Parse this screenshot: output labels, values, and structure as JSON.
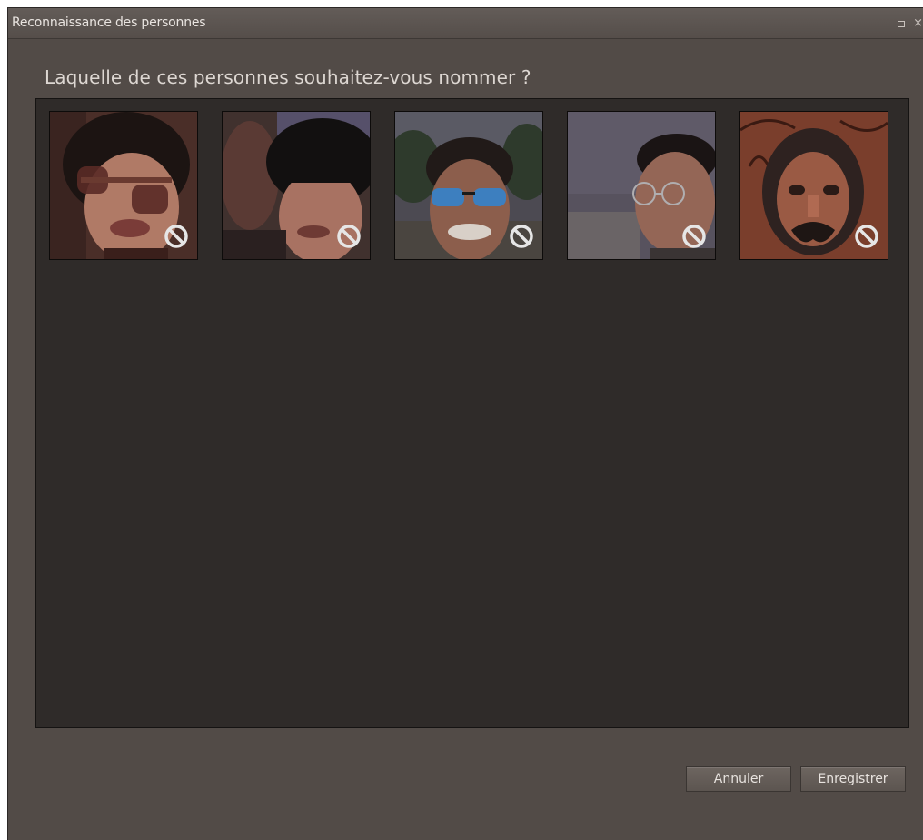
{
  "window": {
    "title": "Reconnaissance des personnes",
    "restore_icon": "restore-icon",
    "close_icon": "close-icon",
    "close_glyph": "×"
  },
  "prompt": {
    "question": "Laquelle de ces personnes souhaitez-vous nommer ?"
  },
  "faces": [
    {
      "id": "face-1",
      "ignore_icon": "ignore-circle-icon",
      "description": "woman with sunglasses"
    },
    {
      "id": "face-2",
      "ignore_icon": "ignore-circle-icon",
      "description": "person with black hat"
    },
    {
      "id": "face-3",
      "ignore_icon": "ignore-circle-icon",
      "description": "man with reflective sunglasses"
    },
    {
      "id": "face-4",
      "ignore_icon": "ignore-circle-icon",
      "description": "man with glasses in profile"
    },
    {
      "id": "face-5",
      "ignore_icon": "ignore-circle-icon",
      "description": "carved statue face"
    }
  ],
  "buttons": {
    "cancel_label": "Annuler",
    "save_label": "Enregistrer"
  },
  "colors": {
    "window_bg": "#524b47",
    "panel_bg": "#2f2b29",
    "text": "#ddd7d2"
  }
}
